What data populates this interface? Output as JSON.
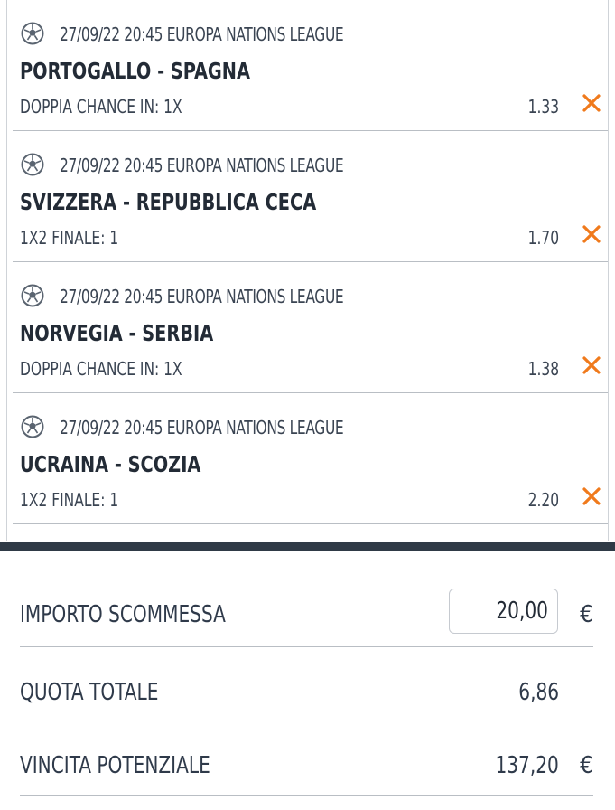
{
  "bets": [
    {
      "event": "27/09/22 20:45 EUROPA NATIONS LEAGUE",
      "match": "PORTOGALLO - SPAGNA",
      "market": "DOPPIA CHANCE IN: 1X",
      "odd": "1.33"
    },
    {
      "event": "27/09/22 20:45 EUROPA NATIONS LEAGUE",
      "match": "SVIZZERA - REPUBBLICA CECA",
      "market": "1X2 FINALE: 1",
      "odd": "1.70"
    },
    {
      "event": "27/09/22 20:45 EUROPA NATIONS LEAGUE",
      "match": "NORVEGIA - SERBIA",
      "market": "DOPPIA CHANCE IN: 1X",
      "odd": "1.38"
    },
    {
      "event": "27/09/22 20:45 EUROPA NATIONS LEAGUE",
      "match": "UCRAINA - SCOZIA",
      "market": "1X2 FINALE: 1",
      "odd": "2.20"
    }
  ],
  "summary": {
    "stake_label": "IMPORTO SCOMMESSA",
    "stake_value": "20,00",
    "stake_currency": "€",
    "total_odds_label": "QUOTA TOTALE",
    "total_odds_value": "6,86",
    "win_label": "VINCITA POTENZIALE",
    "win_value": "137,20",
    "win_currency": "€"
  },
  "colors": {
    "accent": "#f07a1c",
    "divider": "#2f3a46",
    "text": "#2f3a4a"
  },
  "icons": {
    "sport": "soccer-ball-icon",
    "remove": "close-x-icon"
  }
}
